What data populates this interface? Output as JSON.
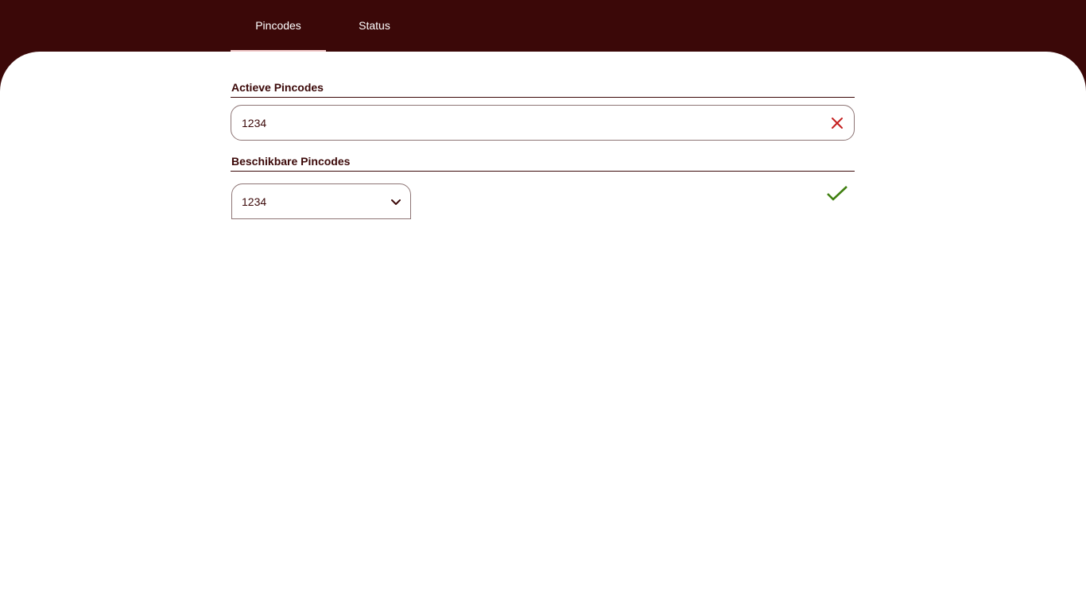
{
  "tabs": [
    {
      "label": "Pincodes",
      "active": true
    },
    {
      "label": "Status",
      "active": false
    }
  ],
  "active_pincodes": {
    "title": "Actieve Pincodes",
    "items": [
      "1234"
    ],
    "remove_icon": "close-icon"
  },
  "available_pincodes": {
    "title": "Beschikbare Pincodes",
    "selected": "1234",
    "select_icon": "chevron-down-icon",
    "confirm_icon": "check-icon"
  },
  "colors": {
    "brand": "#3b0808",
    "remove": "#c41e1e",
    "confirm": "#3f7f10",
    "tab_indicator": "#f2c9c9"
  }
}
